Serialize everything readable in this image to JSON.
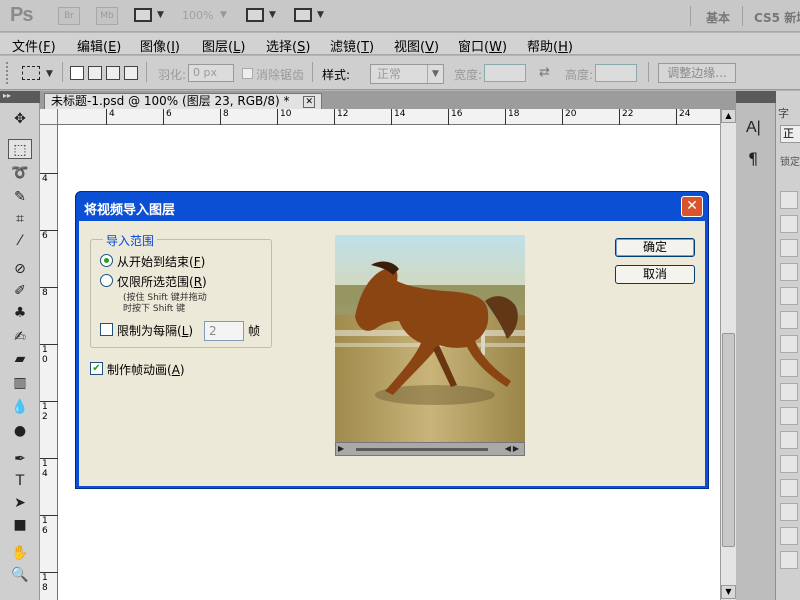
{
  "app": {
    "logo": "Ps",
    "bridge_label": "Br",
    "minibridge_label": "Mb",
    "zoom": "100%",
    "workspace_basic": "基本",
    "workspace_new": "CS5 新增"
  },
  "menu": [
    {
      "label": "文件(",
      "key": "F",
      "end": ")"
    },
    {
      "label": "编辑(",
      "key": "E",
      "end": ")"
    },
    {
      "label": "图像(",
      "key": "I",
      "end": ")"
    },
    {
      "label": "图层(",
      "key": "L",
      "end": ")"
    },
    {
      "label": "选择(",
      "key": "S",
      "end": ")"
    },
    {
      "label": "滤镜(",
      "key": "T",
      "end": ")"
    },
    {
      "label": "视图(",
      "key": "V",
      "end": ")"
    },
    {
      "label": "窗口(",
      "key": "W",
      "end": ")"
    },
    {
      "label": "帮助(",
      "key": "H",
      "end": ")"
    }
  ],
  "options": {
    "feather_label": "羽化:",
    "feather_value": "0 px",
    "antialias_label": "消除锯齿",
    "style_label": "样式:",
    "style_value": "正常",
    "width_label": "宽度:",
    "height_label": "高度:",
    "refine_label": "调整边缘..."
  },
  "document": {
    "tab_title": "未标题-1.psd @ 100% (图层 23, RGB/8) *"
  },
  "ruler": {
    "h_ticks": [
      "4",
      "6",
      "8",
      "10",
      "12",
      "14",
      "16",
      "18",
      "20",
      "22",
      "24"
    ],
    "v_ticks": [
      "4",
      "6",
      "8",
      "1\n0",
      "1\n2",
      "1\n4",
      "1\n6",
      "1\n8"
    ]
  },
  "right_panel": {
    "char_label": "字",
    "style_value": "正常",
    "lock_label": "锁定"
  },
  "dialog": {
    "title": "将视频导入图层",
    "close": "✕",
    "range_group": "导入范围",
    "opt_full_pre": "从开始到结束(",
    "opt_full_key": "F",
    "opt_range_pre": "仅限所选范围(",
    "opt_range_key": "R",
    "opt_end": ")",
    "hint_line1": "(按住 Shift 键并拖动",
    "hint_line2": "时按下 Shift 键",
    "limit_pre": "限制为每隔(",
    "limit_key": "L",
    "limit_value": "2",
    "limit_unit": "帧",
    "anim_pre": "制作帧动画(",
    "anim_key": "A",
    "ok_label": "确定",
    "cancel_label": "取消",
    "selected_option": "full",
    "limit_checked": false,
    "anim_checked": true
  },
  "colors": {
    "title_bar": "#0a4fd4",
    "dialog_body": "#ece9d8",
    "group_legend": "#0046d5",
    "radio_dot": "#21a121",
    "close_btn": "#d9542c"
  }
}
